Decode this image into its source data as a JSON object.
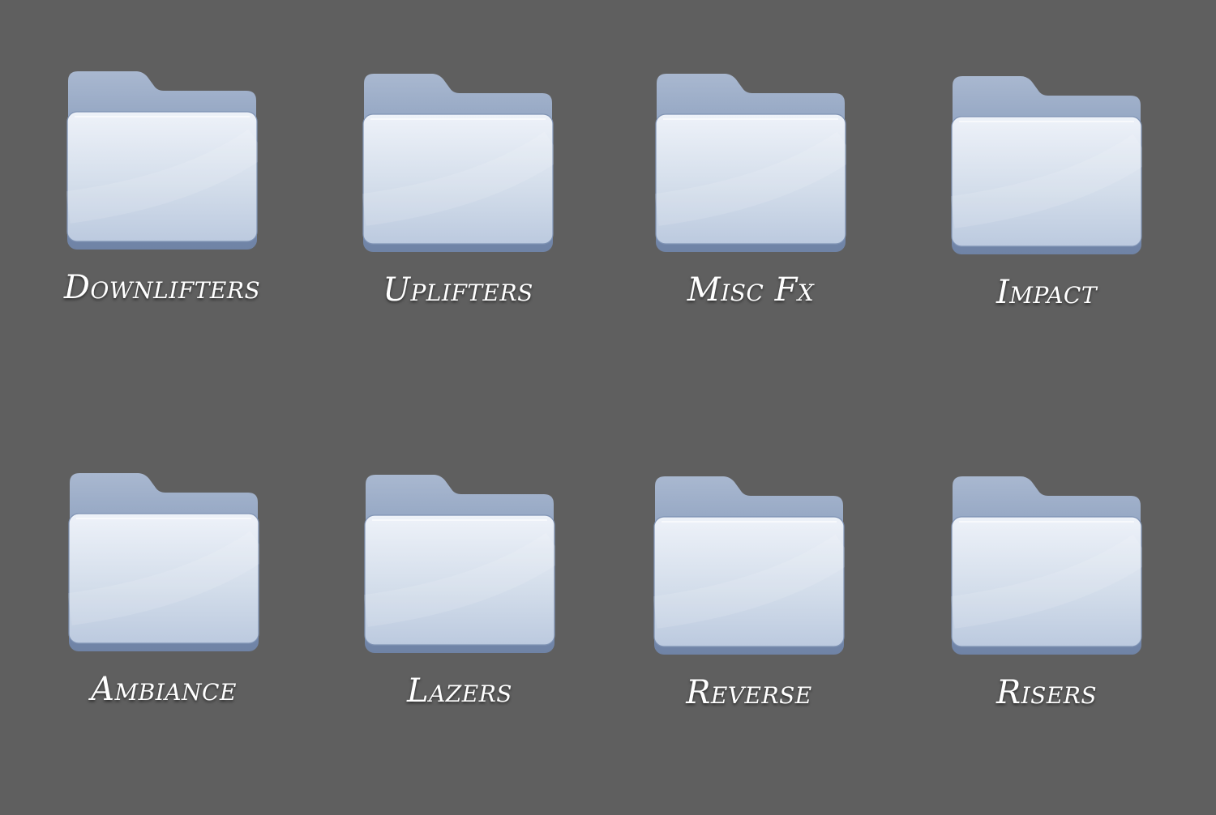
{
  "desktop": {
    "background_color": "#5f5f5f",
    "folders": [
      {
        "label": "Downlifters",
        "icon": "folder-icon"
      },
      {
        "label": "Uplifters",
        "icon": "folder-icon"
      },
      {
        "label": "Misc Fx",
        "icon": "folder-icon"
      },
      {
        "label": "Impact",
        "icon": "folder-icon"
      },
      {
        "label": "Ambiance",
        "icon": "folder-icon"
      },
      {
        "label": "Lazers",
        "icon": "folder-icon"
      },
      {
        "label": "Reverse",
        "icon": "folder-icon"
      },
      {
        "label": "Risers",
        "icon": "folder-icon"
      }
    ]
  }
}
